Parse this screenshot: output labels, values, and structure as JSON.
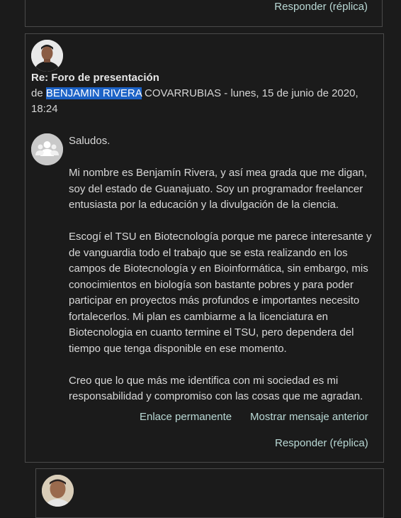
{
  "previous_post": {
    "reply_label": "Responder (réplica)"
  },
  "post": {
    "subject": "Re: Foro de presentación",
    "byline_prefix": "de ",
    "author_highlight": "BENJAMIN RIVERA",
    "byline_rest": " COVARRUBIAS - lunes, 15 de junio de 2020, 18:24",
    "paragraphs": [
      "Saludos.",
      "Mi nombre es Benjamín Rivera, y así mea grada que me digan, soy del estado de Guanajuato. Soy un programador freelancer entusiasta por la educación y la divulgación de la ciencia.",
      "Escogí el TSU en Biotecnología porque me parece interesante y de vanguardia todo el trabajo que se esta realizando en los campos de Biotecnología y en Bioinformática, sin embargo, mis conocimientos en biología son bastante pobres y para poder participar en proyectos más profundos e importantes necesito fortalecerlos. Mi plan es cambiarme a la licenciatura en Biotecnologia en cuanto termine el TSU, pero dependera del tiempo que tenga disponible en ese momento.",
      "Creo que lo que más me identifica con mi sociedad es mi responsabilidad y compromiso con las cosas que me agradan."
    ],
    "permalink_label": "Enlace permanente",
    "show_parent_label": "Mostrar mensaje anterior",
    "reply_label": "Responder (réplica)"
  },
  "colors": {
    "background": "#1b1b1b",
    "border": "#4a4a4a",
    "link": "#b9d9d5",
    "highlight": "#1d63c7"
  }
}
